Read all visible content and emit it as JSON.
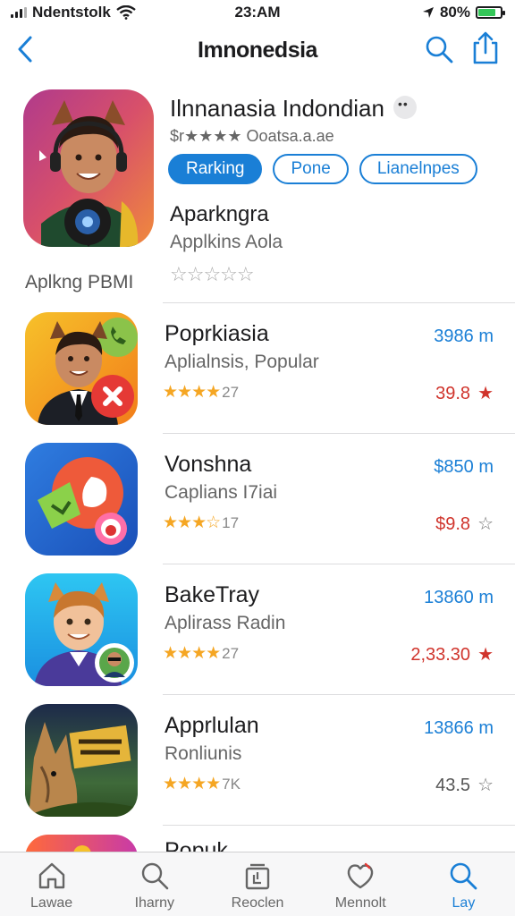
{
  "status_bar": {
    "carrier": "Ndentstolk",
    "time": "23:AM",
    "battery": "80%",
    "battery_level": 0.8
  },
  "nav": {
    "title": "Imnonedsia"
  },
  "hero": {
    "name": "Ilnnanasia Indondian",
    "subtitle": "$r★★★★ Ooatsa.a.ae",
    "chips": [
      "Rarking",
      "Pone",
      "Lianelnpes"
    ],
    "developer": "Aparkngra",
    "developer_sub": "Applkins Aola",
    "rating_outline": "☆☆☆☆☆",
    "caption": "Aplkng PBMI"
  },
  "apps": [
    {
      "name": "Poprkiasia",
      "subtitle": "Aplialnsis, Popular",
      "stars": "★★★★",
      "rating_count": "27",
      "size": "3986 m",
      "price": "39.8",
      "price_star": "★",
      "price_color": "red"
    },
    {
      "name": "Vonshna",
      "subtitle": "Caplians I7iai",
      "stars": "★★★☆",
      "rating_count": "17",
      "size": "$850 m",
      "price": "$9.8",
      "price_star": "☆",
      "price_color": "red"
    },
    {
      "name": "BakeTray",
      "subtitle": "Aplirass Radin",
      "stars": "★★★★",
      "rating_count": "27",
      "size": "13860 m",
      "price": "2,33.30",
      "price_star": "★",
      "price_color": "red"
    },
    {
      "name": "Apprlulan",
      "subtitle": "Ronliunis",
      "stars": "★★★★",
      "rating_count": "7K",
      "size": "13866 m",
      "price": "43.5",
      "price_star": "☆",
      "price_color": "gray"
    },
    {
      "name": "Popuk",
      "subtitle": "",
      "stars": "",
      "rating_count": "",
      "size": "",
      "price": "",
      "price_star": "",
      "price_color": "gray"
    }
  ],
  "tabs": [
    {
      "label": "Lawae",
      "icon": "home-icon"
    },
    {
      "label": "Iharny",
      "icon": "search-icon"
    },
    {
      "label": "Reoclen",
      "icon": "stack-icon"
    },
    {
      "label": "Mennolt",
      "icon": "heart-icon"
    },
    {
      "label": "Lay",
      "icon": "search-icon"
    }
  ],
  "colors": {
    "accent": "#1a7fd6",
    "price_red": "#d0342c",
    "star_yellow": "#f5a623"
  }
}
